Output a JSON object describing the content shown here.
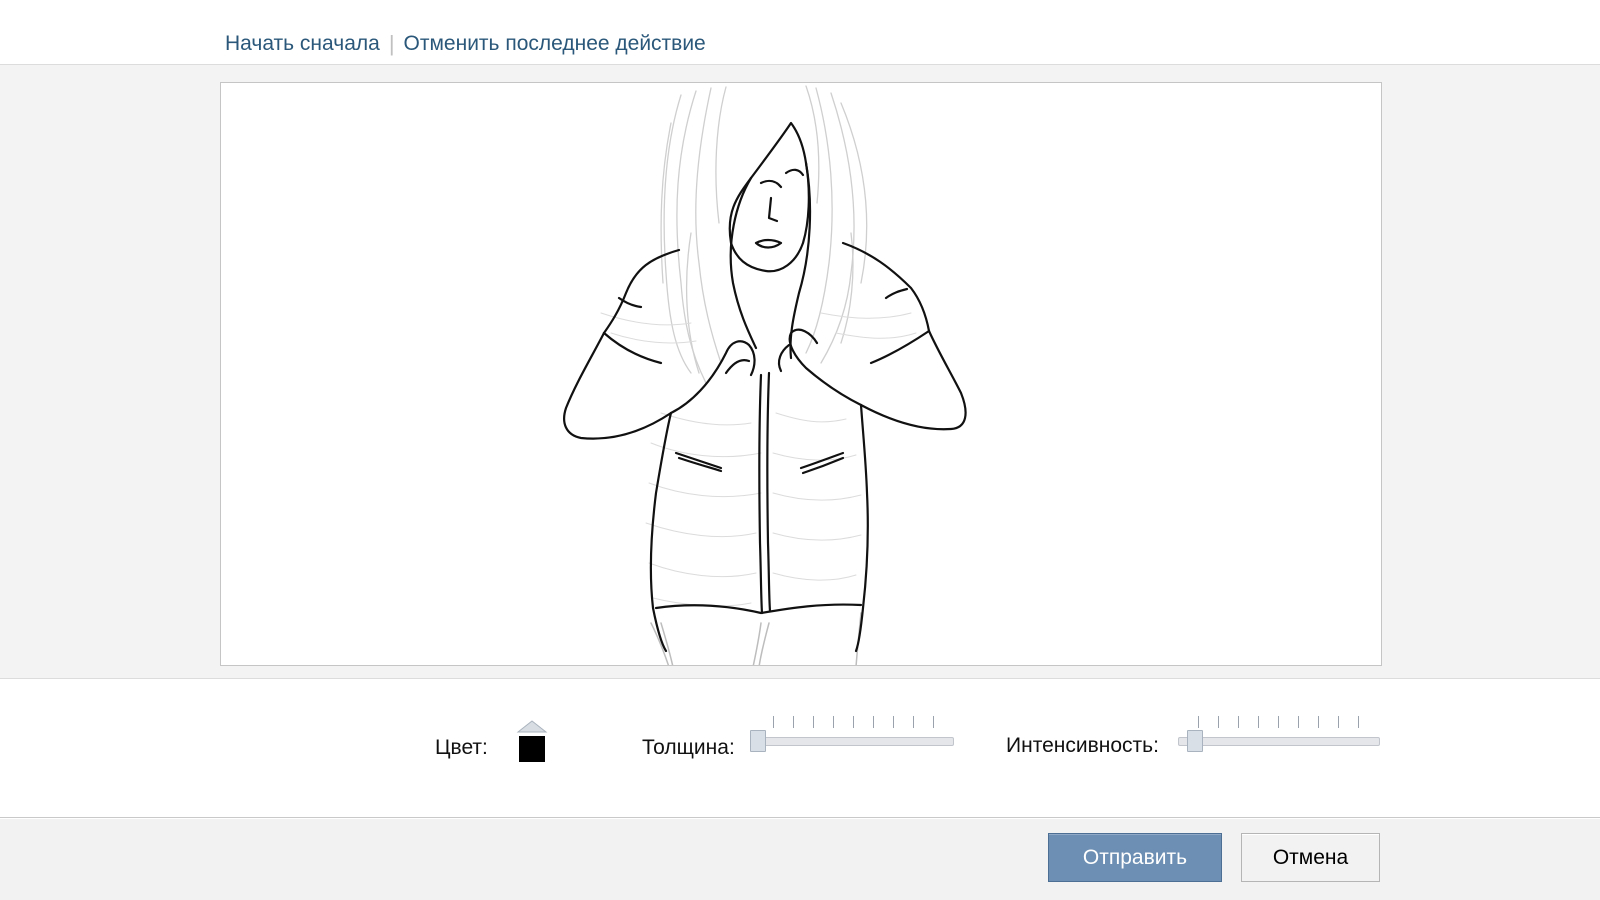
{
  "toolbar": {
    "restart_label": "Начать сначала",
    "undo_label": "Отменить последнее действие"
  },
  "tools": {
    "color_label": "Цвет:",
    "color_value": "#000000",
    "thickness_label": "Толщина:",
    "thickness_level": 0,
    "intensity_label": "Интенсивность:",
    "intensity_level": 0.05
  },
  "buttons": {
    "send_label": "Отправить",
    "cancel_label": "Отмена"
  },
  "colors": {
    "link": "#2b587a",
    "primary_button": "#6d8fb3"
  }
}
